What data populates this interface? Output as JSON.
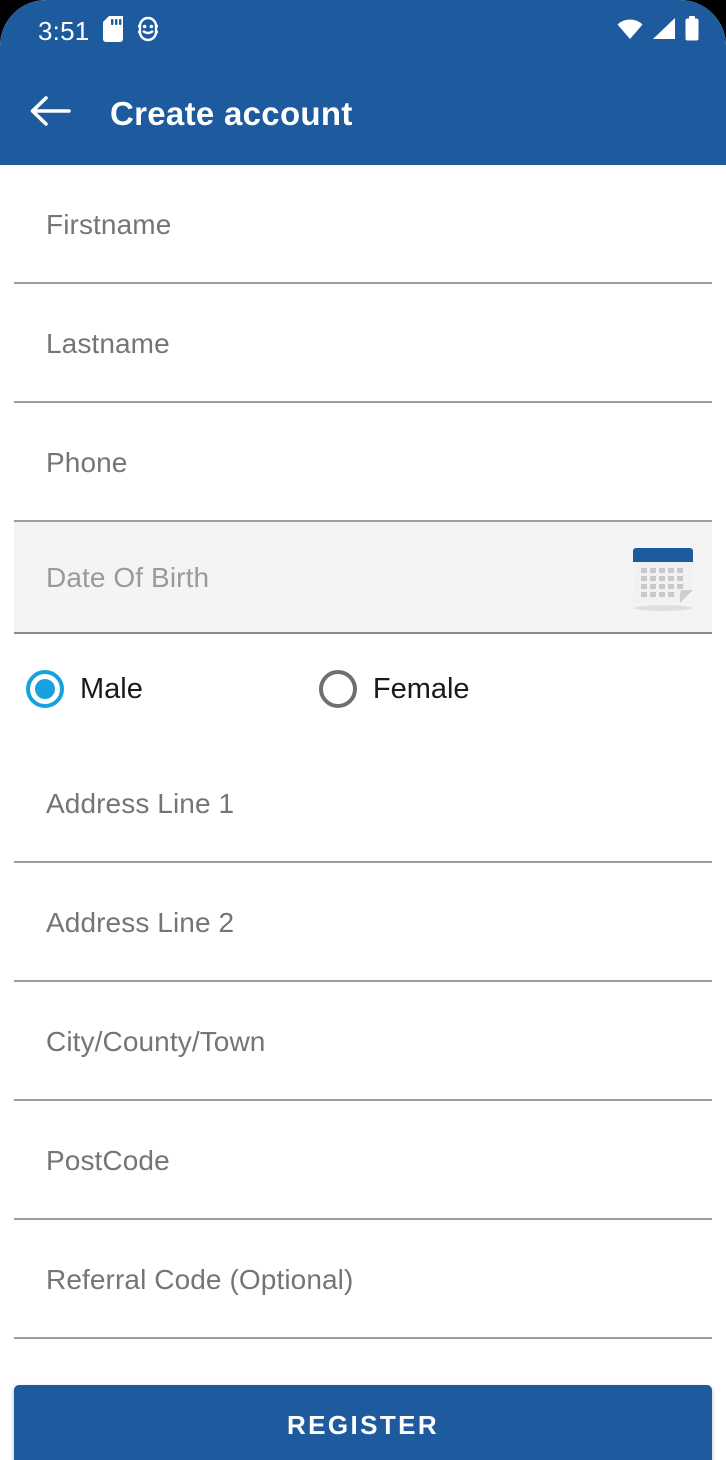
{
  "statusbar": {
    "time": "3:51",
    "icons_left": [
      "sd-card-icon",
      "android-debug-icon"
    ],
    "icons_right": [
      "wifi-icon",
      "cellular-signal-icon",
      "battery-full-icon"
    ]
  },
  "appbar": {
    "back_icon": "back-arrow-icon",
    "title": "Create account",
    "background_color": "#1d5b9e",
    "text_color": "#ffffff"
  },
  "form": {
    "fields": [
      {
        "name": "firstname",
        "placeholder": "Firstname",
        "value": ""
      },
      {
        "name": "lastname",
        "placeholder": "Lastname",
        "value": ""
      },
      {
        "name": "phone",
        "placeholder": "Phone",
        "value": ""
      }
    ],
    "date_of_birth": {
      "name": "date-of-birth",
      "placeholder": "Date Of Birth",
      "value": "",
      "icon": "calendar-icon",
      "focused": true,
      "background_color": "#f4f4f4"
    },
    "gender": {
      "selected": "Male",
      "options": [
        {
          "label": "Male",
          "selected": true
        },
        {
          "label": "Female",
          "selected": false
        }
      ],
      "selected_color": "#17a2dd",
      "unselected_color": "#6f6f6f"
    },
    "address_fields": [
      {
        "name": "address-line-1",
        "placeholder": "Address Line 1",
        "value": ""
      },
      {
        "name": "address-line-2",
        "placeholder": "Address Line 2",
        "value": ""
      },
      {
        "name": "city",
        "placeholder": "City/County/Town",
        "value": ""
      },
      {
        "name": "postcode",
        "placeholder": "PostCode",
        "value": ""
      },
      {
        "name": "referral-code",
        "placeholder": "Referral Code (Optional)",
        "value": ""
      }
    ]
  },
  "actions": {
    "register_label": "REGISTER",
    "register_color": "#1d5b9e"
  }
}
